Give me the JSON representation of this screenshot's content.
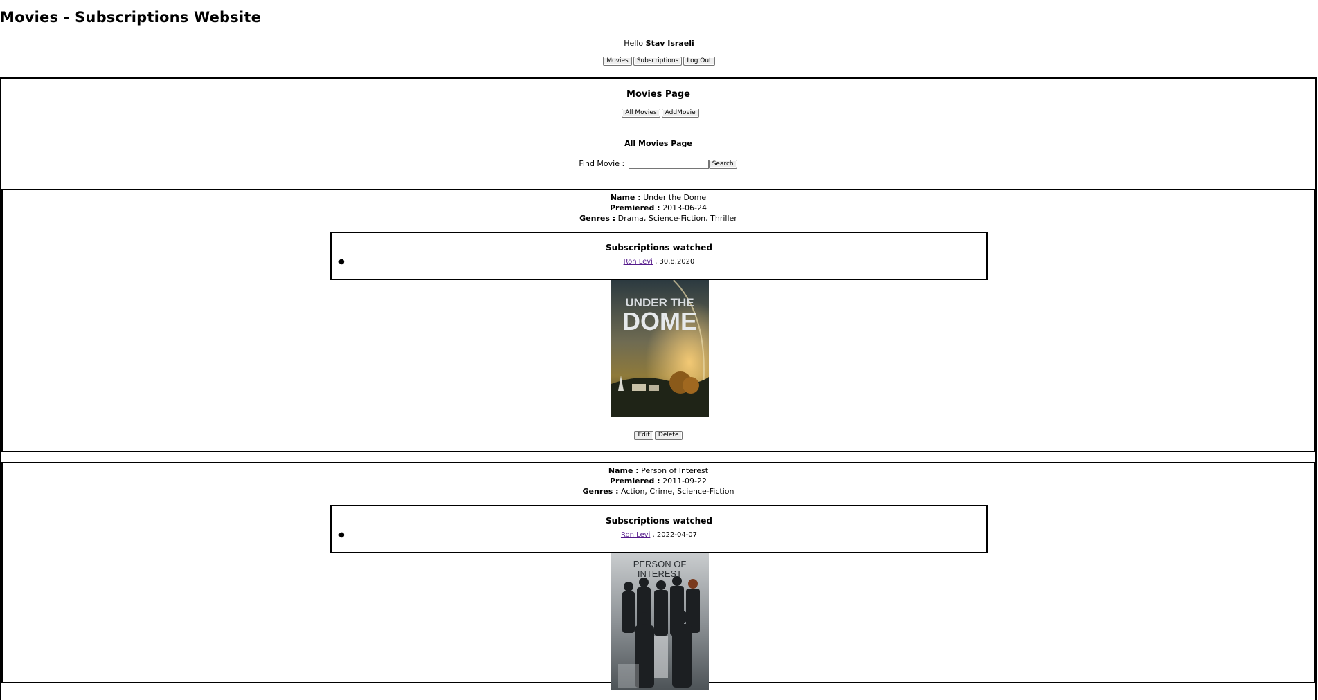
{
  "site": {
    "title": "Movies - Subscriptions Website",
    "greeting_prefix": "Hello",
    "user_name": "Stav Israeli"
  },
  "nav": {
    "movies": "Movies",
    "subscriptions": "Subscriptions",
    "logout": "Log Out"
  },
  "movies_page": {
    "heading": "Movies Page",
    "all_movies_button": "All Movies",
    "add_movie_button": "AddMovie",
    "sub_heading": "All Movies Page",
    "find_label": "Find Movie :",
    "search_value": "",
    "search_button": "Search"
  },
  "labels": {
    "name": "Name :",
    "premiered": "Premiered :",
    "genres": "Genres :",
    "subscriptions_watched": "Subscriptions watched",
    "edit": "Edit",
    "delete": "Delete"
  },
  "movies": [
    {
      "name": "Under the Dome",
      "premiered": "2013-06-24",
      "genres": "Drama, Science-Fiction, Thriller",
      "subscriptions": [
        {
          "member": "Ron Levi",
          "date": "30.8.2020"
        }
      ],
      "poster_text": [
        "UNDER THE",
        "DOME"
      ]
    },
    {
      "name": "Person of Interest",
      "premiered": "2011-09-22",
      "genres": "Action, Crime, Science-Fiction",
      "subscriptions": [
        {
          "member": "Ron Levi",
          "date": "2022-04-07"
        }
      ],
      "poster_text": [
        "PERSON OF",
        "INTEREST"
      ]
    }
  ]
}
